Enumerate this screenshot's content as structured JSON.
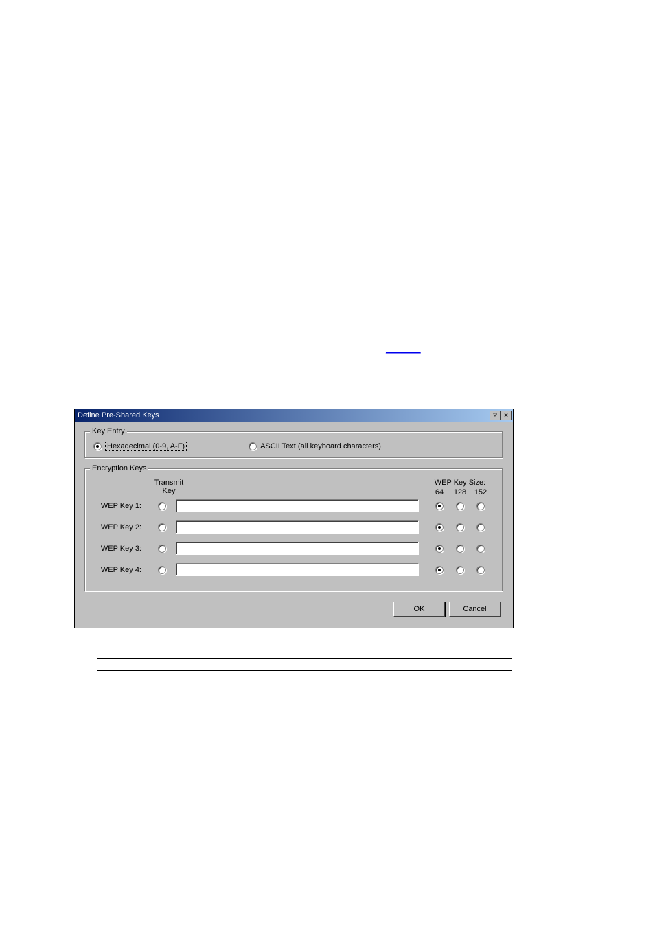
{
  "link": {
    "text": "_______"
  },
  "dialog": {
    "title": "Define Pre-Shared Keys",
    "help_button": "?",
    "close_button": "×",
    "key_entry": {
      "legend": "Key Entry",
      "hex_label": "Hexadecimal (0-9, A-F)",
      "ascii_label": "ASCII Text (all keyboard characters)",
      "selected": "hex"
    },
    "encryption": {
      "legend": "Encryption Keys",
      "transmit_key_label_line1": "Transmit",
      "transmit_key_label_line2": "Key",
      "wep_key_size_label": "WEP Key Size:",
      "size_64": "64",
      "size_128": "128",
      "size_152": "152",
      "keys": [
        {
          "label": "WEP Key 1:",
          "value": "",
          "size": "64"
        },
        {
          "label": "WEP Key 2:",
          "value": "",
          "size": "64"
        },
        {
          "label": "WEP Key 3:",
          "value": "",
          "size": "64"
        },
        {
          "label": "WEP Key 4:",
          "value": "",
          "size": "64"
        }
      ]
    },
    "buttons": {
      "ok": "OK",
      "cancel": "Cancel"
    }
  }
}
